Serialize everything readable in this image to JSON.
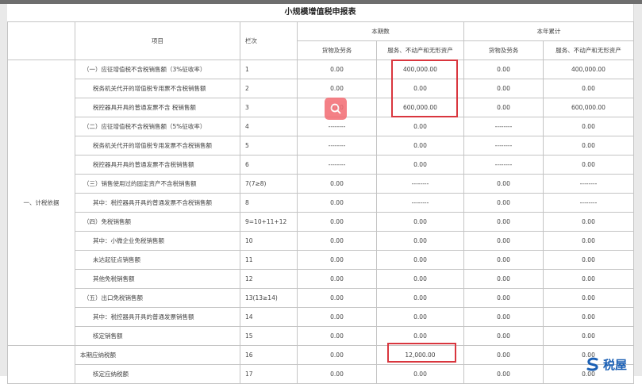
{
  "title": "小规模增值税申报表",
  "headers": {
    "item": "项目",
    "line_no": "栏次",
    "current_period": "本期数",
    "ytd": "本年累计",
    "goods": "货物及劳务",
    "services": "服务、不动产和无形资产"
  },
  "section_label": "一、计税依据",
  "rows": [
    {
      "item": "（一）应征增值税不含税销售额（3%征收率）",
      "line": "1",
      "cp_goods": "0.00",
      "cp_services": "400,000.00",
      "ytd_goods": "0.00",
      "ytd_services": "400,000.00"
    },
    {
      "item": "税务机关代开的增值税专用票不含税销售额",
      "line": "2",
      "cp_goods": "0.00",
      "cp_services": "0.00",
      "ytd_goods": "0.00",
      "ytd_services": "0.00"
    },
    {
      "item": "税控器具开具的普通发票不含 税销售额",
      "line": "3",
      "cp_goods": "0.00",
      "cp_services": "600,000.00",
      "ytd_goods": "0.00",
      "ytd_services": "600,000.00"
    },
    {
      "item": "（二）应征增值税不含税销售额（5%征收率）",
      "line": "4",
      "cp_goods": "--------",
      "cp_services": "0.00",
      "ytd_goods": "--------",
      "ytd_services": "0.00"
    },
    {
      "item": "税务机关代开的增值税专用发票不含税销售额",
      "line": "5",
      "cp_goods": "--------",
      "cp_services": "0.00",
      "ytd_goods": "--------",
      "ytd_services": "0.00"
    },
    {
      "item": "税控器具开具的普通发票不含税销售额",
      "line": "6",
      "cp_goods": "--------",
      "cp_services": "0.00",
      "ytd_goods": "--------",
      "ytd_services": "0.00"
    },
    {
      "item": "（三）销售使用过的固定资产不含税销售额",
      "line": "7(7≥8)",
      "cp_goods": "0.00",
      "cp_services": "--------",
      "ytd_goods": "0.00",
      "ytd_services": "--------"
    },
    {
      "item": "其中：税控器具开具的普通发票不含税销售额",
      "line": "8",
      "cp_goods": "0.00",
      "cp_services": "--------",
      "ytd_goods": "0.00",
      "ytd_services": "--------"
    },
    {
      "item": "（四）免税销售额",
      "line": "9=10+11+12",
      "cp_goods": "0.00",
      "cp_services": "0.00",
      "ytd_goods": "0.00",
      "ytd_services": "0.00"
    },
    {
      "item": "其中：小微企业免税销售额",
      "line": "10",
      "cp_goods": "0.00",
      "cp_services": "0.00",
      "ytd_goods": "0.00",
      "ytd_services": "0.00"
    },
    {
      "item": "未达起征点销售额",
      "line": "11",
      "cp_goods": "0.00",
      "cp_services": "0.00",
      "ytd_goods": "0.00",
      "ytd_services": "0.00"
    },
    {
      "item": "其他免税销售额",
      "line": "12",
      "cp_goods": "0.00",
      "cp_services": "0.00",
      "ytd_goods": "0.00",
      "ytd_services": "0.00"
    },
    {
      "item": "（五）出口免税销售额",
      "line": "13(13≥14)",
      "cp_goods": "0.00",
      "cp_services": "0.00",
      "ytd_goods": "0.00",
      "ytd_services": "0.00"
    },
    {
      "item": "其中：税控器具开具的普通发票销售额",
      "line": "14",
      "cp_goods": "0.00",
      "cp_services": "0.00",
      "ytd_goods": "0.00",
      "ytd_services": "0.00"
    },
    {
      "item": "核定销售额",
      "line": "15",
      "cp_goods": "0.00",
      "cp_services": "0.00",
      "ytd_goods": "0.00",
      "ytd_services": "0.00"
    }
  ],
  "tax_rows": [
    {
      "item": "本期应纳税额",
      "line": "16",
      "cp_goods": "0.00",
      "cp_services": "12,000.00",
      "ytd_goods": "0.00",
      "ytd_services": "0.00"
    },
    {
      "item": "核定应纳税额",
      "line": "17",
      "cp_goods": "0.00",
      "cp_services": "0.00",
      "ytd_goods": "0.00",
      "ytd_services": "0.00"
    }
  ],
  "logo": {
    "text": "税屋",
    "sub": "SHUIWU",
    "icon": "s-logo-icon"
  },
  "overlay": {
    "icon": "search-icon"
  },
  "colors": {
    "highlight": "#d9363e",
    "logo": "#1a5fb4",
    "search_badge": "#f36b72"
  }
}
